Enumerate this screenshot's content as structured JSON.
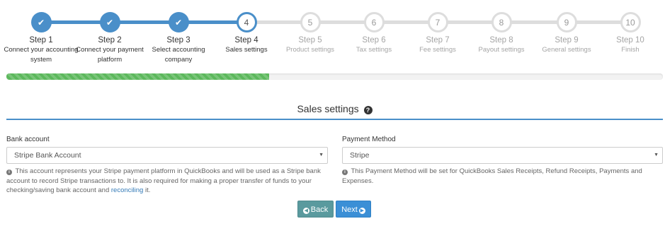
{
  "steps": [
    {
      "num": "1",
      "title": "Step 1",
      "sub1": "Connect your accounting",
      "sub2": "system",
      "state": "done"
    },
    {
      "num": "2",
      "title": "Step 2",
      "sub1": "Connect your payment",
      "sub2": "platform",
      "state": "done"
    },
    {
      "num": "3",
      "title": "Step 3",
      "sub1": "Select accounting",
      "sub2": "company",
      "state": "done"
    },
    {
      "num": "4",
      "title": "Step 4",
      "sub1": "Sales settings",
      "sub2": "",
      "state": "active"
    },
    {
      "num": "5",
      "title": "Step 5",
      "sub1": "Product settings",
      "sub2": "",
      "state": "todo"
    },
    {
      "num": "6",
      "title": "Step 6",
      "sub1": "Tax settings",
      "sub2": "",
      "state": "todo"
    },
    {
      "num": "7",
      "title": "Step 7",
      "sub1": "Fee settings",
      "sub2": "",
      "state": "todo"
    },
    {
      "num": "8",
      "title": "Step 8",
      "sub1": "Payout settings",
      "sub2": "",
      "state": "todo"
    },
    {
      "num": "9",
      "title": "Step 9",
      "sub1": "General settings",
      "sub2": "",
      "state": "todo"
    },
    {
      "num": "10",
      "title": "Step 10",
      "sub1": "Finish",
      "sub2": "",
      "state": "todo"
    }
  ],
  "done_check_glyph": "✔",
  "progress": {
    "fraction": 0.4,
    "color": "#5cb85c"
  },
  "section": {
    "title": "Sales settings",
    "help_glyph": "?"
  },
  "bank_account": {
    "label": "Bank account",
    "value": "Stripe Bank Account",
    "help_before_link": "This account represents your Stripe payment platform in QuickBooks and will be used as a Stripe bank account to record Stripe transactions to. It is also required for making a proper transfer of funds to your checking/saving bank account and ",
    "help_link": "reconciling",
    "help_after_link": " it."
  },
  "payment_method": {
    "label": "Payment Method",
    "value": "Stripe",
    "help": "This Payment Method will be set for QuickBooks Sales Receipts, Refund Receipts, Payments and Expenses."
  },
  "buttons": {
    "back": "Back",
    "next": "Next"
  },
  "icons": {
    "info": "i",
    "caret": "▼",
    "back_arrow": "◀",
    "next_arrow": "▶",
    "check": "check-icon",
    "help": "question-circle-icon"
  },
  "colors": {
    "accent": "#4a8fc9",
    "inactive": "#dddddd",
    "back_button": "#5a9a9e",
    "next_button": "#3b8fd6",
    "link": "#337ab7"
  }
}
